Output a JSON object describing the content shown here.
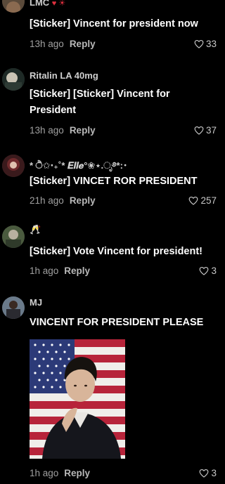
{
  "comments": [
    {
      "username": "LMC",
      "username_suffix": "♥ ☀",
      "text": "[Sticker] Vincent for president now",
      "time": "13h ago",
      "reply_label": "Reply",
      "likes": "33"
    },
    {
      "username": "Ritalin LA 40mg",
      "text": "[Sticker] [Sticker] Vincent for President",
      "time": "13h ago",
      "reply_label": "Reply",
      "likes": "37"
    },
    {
      "username": "* ੈ✩‧₊˚* 𝑬𝒍𝒍𝒆°❀⋆.ೃ࿔*:･",
      "text": "[Sticker] VINCET ROR PRESIDENT",
      "time": "21h ago",
      "reply_label": "Reply",
      "likes": "257"
    },
    {
      "username": "🥂",
      "text": "[Sticker] Vote Vincent for president!",
      "time": "1h ago",
      "reply_label": "Reply",
      "likes": "3"
    },
    {
      "username": "MJ",
      "text": "VINCENT FOR PRESIDENT PLEASE",
      "time": "1h ago",
      "reply_label": "Reply",
      "likes": "3"
    }
  ],
  "icons": {
    "like": "heart-outline-icon"
  },
  "colors": {
    "background": "#000000",
    "text": "#ffffff",
    "muted": "#a0a0a0",
    "heart_red": "#e0303f"
  }
}
